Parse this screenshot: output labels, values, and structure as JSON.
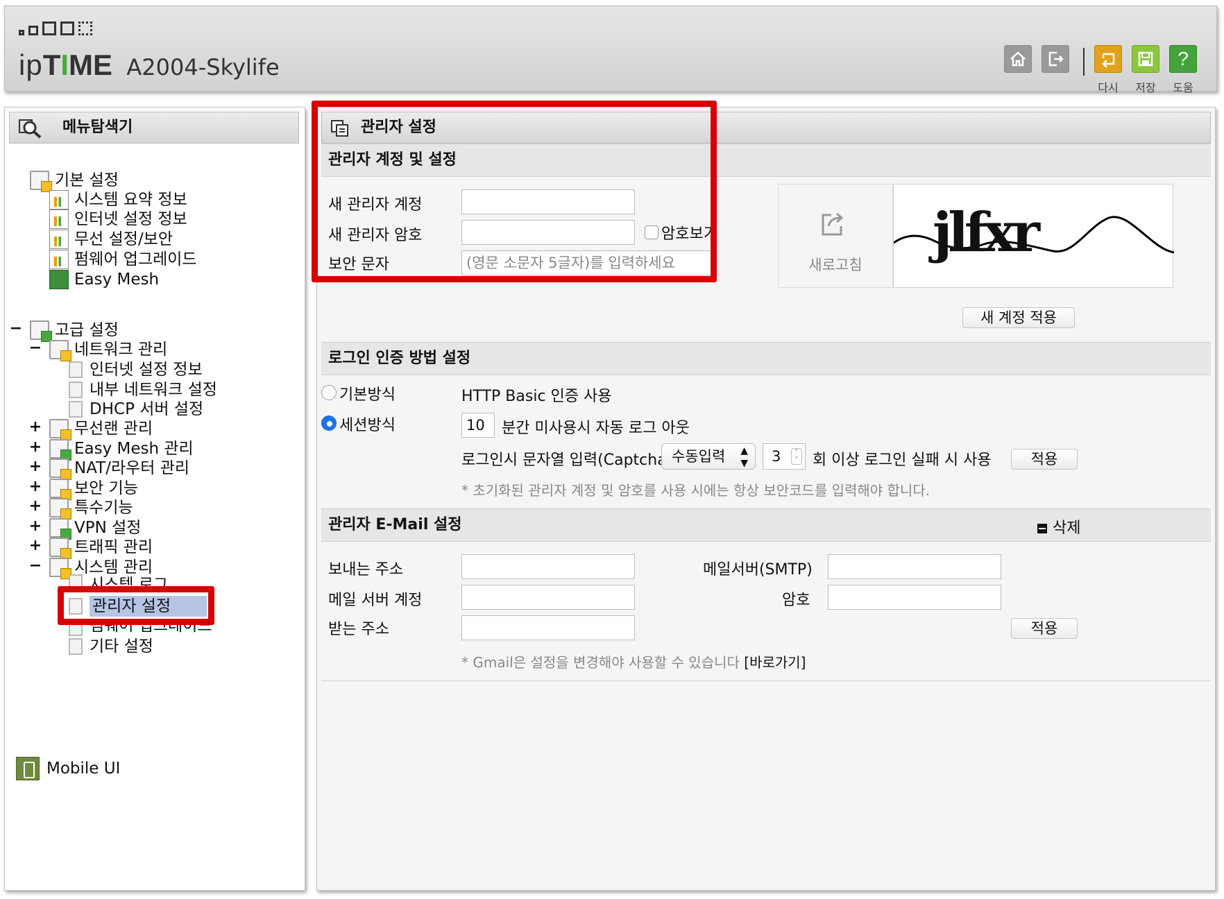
{
  "header": {
    "brand_ip": "ip",
    "brand_t": "T",
    "brand_i": "I",
    "brand_me": "ME",
    "model": "A2004-Skylife",
    "buttons": [
      {
        "label": "다시",
        "icon": "undo-icon"
      },
      {
        "label": "저장",
        "icon": "save-icon"
      },
      {
        "label": "도움",
        "icon": "help-icon"
      }
    ],
    "help_glyph": "?"
  },
  "sidebar": {
    "title": "메뉴탐색기",
    "basic": {
      "label": "기본 설정",
      "items": [
        "시스템 요약 정보",
        "인터넷 설정 정보",
        "무선 설정/보안",
        "펌웨어 업그레이드",
        "Easy Mesh"
      ]
    },
    "advanced": {
      "label": "고급 설정",
      "expander": "−",
      "groups": [
        {
          "label": "네트워크 관리",
          "expander": "−",
          "children": [
            "인터넷 설정 정보",
            "내부 네트워크 설정",
            "DHCP 서버 설정"
          ]
        },
        {
          "label": "무선랜 관리",
          "expander": "+"
        },
        {
          "label": "Easy Mesh 관리",
          "expander": "+"
        },
        {
          "label": "NAT/라우터 관리",
          "expander": "+"
        },
        {
          "label": "보안 기능",
          "expander": "+"
        },
        {
          "label": "특수기능",
          "expander": "+"
        },
        {
          "label": "VPN 설정",
          "expander": "+"
        },
        {
          "label": "트래픽 관리",
          "expander": "+"
        },
        {
          "label": "시스템 관리",
          "expander": "−",
          "children": [
            "시스템 로그",
            "관리자 설정",
            "펌웨어 업그레이드",
            "기타 설정"
          ]
        }
      ]
    },
    "mobile_ui": "Mobile UI"
  },
  "main": {
    "title": "관리자 설정",
    "account": {
      "header": "관리자 계정 및 설정",
      "new_account_label": "새 관리자 계정",
      "new_password_label": "새 관리자 암호",
      "show_password_label": "암호보기",
      "security_text_label": "보안 문자",
      "security_text_placeholder": "(영문 소문자 5글자)를 입력하세요",
      "refresh_label": "새로고침",
      "captcha_text": "jlfxr",
      "apply_new_account": "새 계정 적용"
    },
    "login": {
      "header": "로그인 인증 방법 설정",
      "basic_label": "기본방식",
      "basic_desc": "HTTP Basic 인증 사용",
      "session_label": "세션방식",
      "session_minutes": "10",
      "session_desc": "분간 미사용시 자동 로그 아웃",
      "captcha_label": "로그인시 문자열 입력(Captcha)",
      "captcha_mode": "수동입력",
      "fail_count": "3",
      "fail_desc": "회 이상 로그인 실패 시 사용",
      "apply": "적용",
      "note": "* 초기화된 관리자 계정 및 암호를 사용 시에는 항상 보안코드를 입력해야 합니다."
    },
    "email": {
      "header": "관리자 E-Mail 설정",
      "delete": "삭제",
      "sender_label": "보내는 주소",
      "smtp_label": "메일서버(SMTP)",
      "account_label": "메일 서버 계정",
      "password_label": "암호",
      "recipient_label": "받는 주소",
      "apply": "적용",
      "note": "* Gmail은 설정을 변경해야 사용할 수 있습니다 ",
      "note_link": "[바로가기]"
    }
  },
  "colors": {
    "highlight_red": "#d80000",
    "selected_bg": "#b6c5e6",
    "radio_on": "#1a73e8"
  }
}
